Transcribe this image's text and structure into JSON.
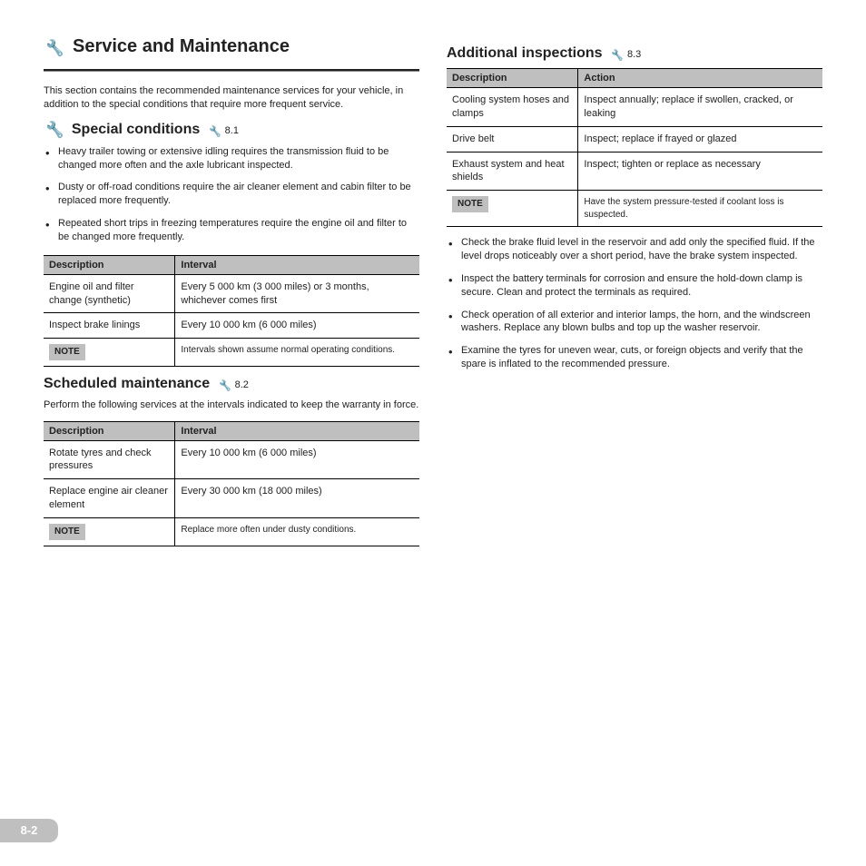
{
  "left": {
    "section_title_icon": "🔧",
    "section_title": "Service and Maintenance",
    "intro": "This section contains the recommended maintenance services for your vehicle, in addition to the special conditions that require more frequent service.",
    "sub1": {
      "icon": "🔧",
      "title": "Special conditions",
      "ref_icon": "🔧",
      "ref": "8.1",
      "bullets": [
        "Heavy trailer towing or extensive idling requires the transmission fluid to be changed more often and the axle lubricant inspected.",
        "Dusty or off-road conditions require the air cleaner element and cabin filter to be replaced more frequently.",
        "Repeated short trips in freezing temperatures require the engine oil and filter to be changed more frequently."
      ]
    },
    "table1": {
      "h1": "Description",
      "h2": "Interval",
      "rows": [
        [
          "Engine oil and filter change (synthetic)",
          "Every 5 000 km (3 000 miles) or 3 months, whichever comes first"
        ],
        [
          "Inspect brake linings",
          "Every 10 000 km (6 000 miles)"
        ]
      ],
      "note_label": "NOTE",
      "note": "Intervals shown assume normal operating conditions."
    },
    "sub2": {
      "title": "Scheduled maintenance",
      "ref_icon": "🔧",
      "ref": "8.2",
      "intro": "Perform the following services at the intervals indicated to keep the warranty in force."
    },
    "table2": {
      "h1": "Description",
      "h2": "Interval",
      "rows": [
        [
          "Rotate tyres and check pressures",
          "Every 10 000 km (6 000 miles)"
        ],
        [
          "Replace engine air cleaner element",
          "Every 30 000 km (18 000 miles)"
        ]
      ],
      "note_label": "NOTE",
      "note": "Replace more often under dusty conditions."
    }
  },
  "right": {
    "sub": {
      "title": "Additional inspections",
      "ref_icon": "🔧",
      "ref": "8.3"
    },
    "table": {
      "h1": "Description",
      "h2": "Action",
      "rows": [
        [
          "Cooling system hoses and clamps",
          "Inspect annually; replace if swollen, cracked, or leaking"
        ],
        [
          "Drive belt",
          "Inspect; replace if frayed or glazed"
        ],
        [
          "Exhaust system and heat shields",
          "Inspect; tighten or replace as necessary"
        ]
      ],
      "note_label": "NOTE",
      "note": "Have the system pressure-tested if coolant loss is suspected."
    },
    "bullets": [
      "Check the brake fluid level in the reservoir and add only the specified fluid. If the level drops noticeably over a short period, have the brake system inspected.",
      "Inspect the battery terminals for corrosion and ensure the hold-down clamp is secure. Clean and protect the terminals as required.",
      "Check operation of all exterior and interior lamps, the horn, and the windscreen washers. Replace any blown bulbs and top up the washer reservoir.",
      "Examine the tyres for uneven wear, cuts, or foreign objects and verify that the spare is inflated to the recommended pressure."
    ]
  },
  "page_number": "8-2"
}
